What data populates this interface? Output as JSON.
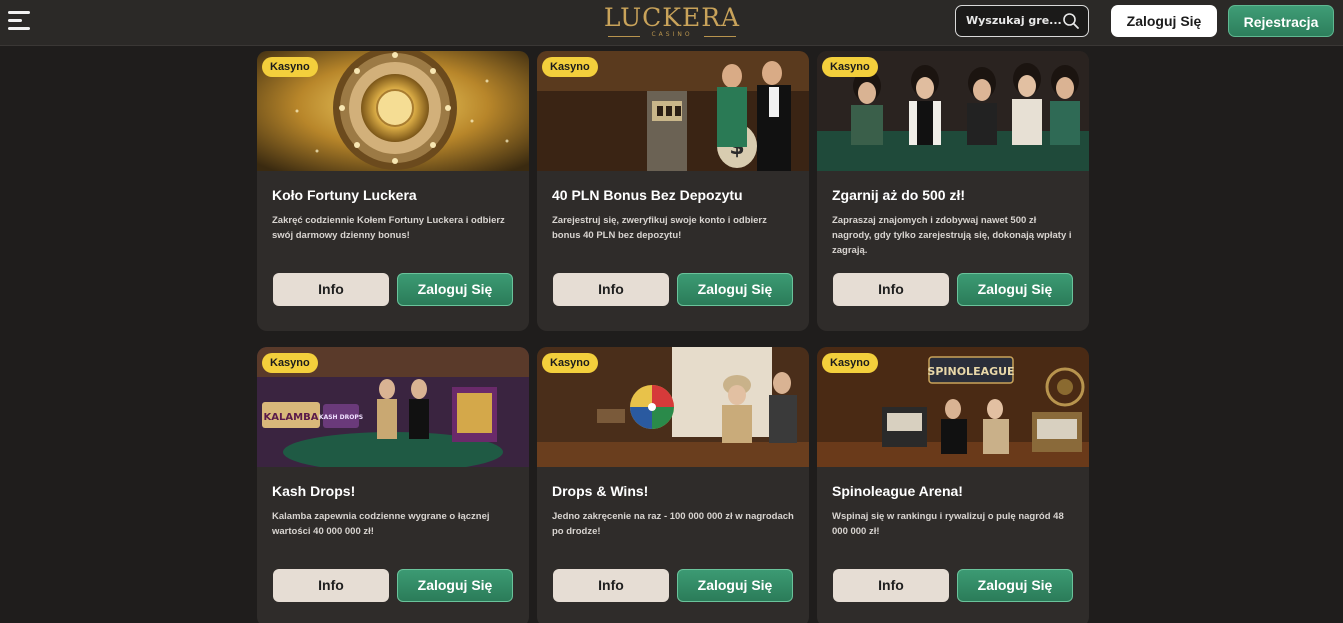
{
  "header": {
    "menu_icon": "hamburger-menu-icon",
    "logo_text": "LUCKERA",
    "logo_sub": "CASINO",
    "search_placeholder": "Wyszukaj gre...",
    "search_icon": "search-icon",
    "login_label": "Zaloguj Się",
    "register_label": "Rejestracja",
    "colors": {
      "brand_gold": "#c9a35a",
      "accent_green": "#2f8a64",
      "badge_yellow": "#f3cf3c"
    }
  },
  "promotions": [
    {
      "badge": "Kasyno",
      "title": "Koło Fortuny Luckera",
      "description": "Zakręć codziennie Kołem Fortuny Luckera i odbierz swój darmowy dzienny bonus!",
      "info_label": "Info",
      "login_label": "Zaloguj Się"
    },
    {
      "badge": "Kasyno",
      "title": "40 PLN Bonus Bez Depozytu",
      "description": "Zarejestruj się, zweryfikuj swoje konto i odbierz bonus 40 PLN bez depozytu!",
      "info_label": "Info",
      "login_label": "Zaloguj Się"
    },
    {
      "badge": "Kasyno",
      "title": "Zgarnij aż do 500 zł!",
      "description": "Zapraszaj znajomych i zdobywaj nawet 500 zł nagrody, gdy tylko zarejestrują się, dokonają wpłaty i zagrają.",
      "info_label": "Info",
      "login_label": "Zaloguj Się"
    },
    {
      "badge": "Kasyno",
      "title": "Kash Drops!",
      "description": "Kalamba zapewnia codzienne wygrane o łącznej wartości 40 000 000 zł!",
      "info_label": "Info",
      "login_label": "Zaloguj Się",
      "image_text": [
        "KALAMBA",
        "KASH DROPS"
      ]
    },
    {
      "badge": "Kasyno",
      "title": "Drops & Wins!",
      "description": "Jedno zakręcenie na raz - 100 000 000 zł w nagrodach po drodze!",
      "info_label": "Info",
      "login_label": "Zaloguj Się"
    },
    {
      "badge": "Kasyno",
      "title": "Spinoleague Arena!",
      "description": "Wspinaj się w rankingu i rywalizuj o pulę nagród 48 000 000 zł!",
      "info_label": "Info",
      "login_label": "Zaloguj Się",
      "image_text": [
        "SPINOLEAGUE"
      ]
    }
  ]
}
